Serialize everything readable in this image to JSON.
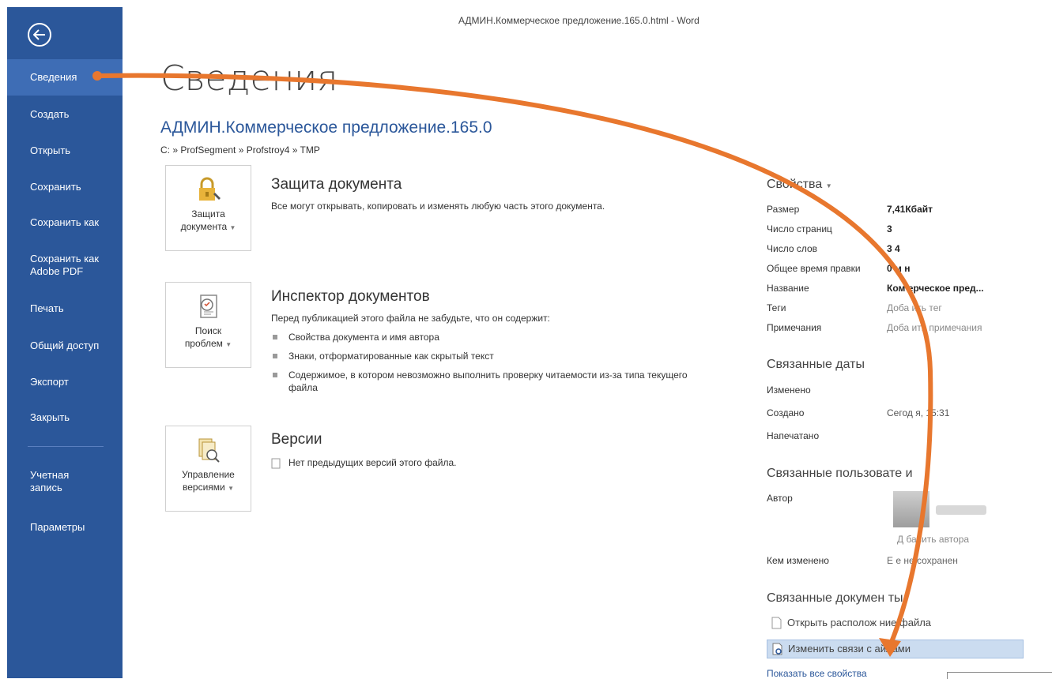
{
  "window": {
    "title": "АДМИН.Коммерческое предложение.165.0.html - Word"
  },
  "sidebar": {
    "items": [
      {
        "label": "Сведения"
      },
      {
        "label": "Создать"
      },
      {
        "label": "Открыть"
      },
      {
        "label": "Сохранить"
      },
      {
        "label": "Сохранить как"
      },
      {
        "label": "Сохранить как\nAdobe PDF"
      },
      {
        "label": "Печать"
      },
      {
        "label": "Общий доступ"
      },
      {
        "label": "Экспорт"
      },
      {
        "label": "Закрыть"
      },
      {
        "label": "Учетная\nзапись"
      },
      {
        "label": "Параметры"
      }
    ]
  },
  "main": {
    "page_title": "Сведения",
    "doc_name": "АДМИН.Коммерческое предложение.165.0",
    "doc_path": "C: » ProfSegment » Profstroy4 » TMP",
    "protect": {
      "tile_label": "Защита\nдокумента",
      "title": "Защита документа",
      "desc": "Все могут открывать, копировать и изменять любую часть этого документа."
    },
    "inspect": {
      "tile_label": "Поиск\nпроблем",
      "title": "Инспектор документов",
      "desc": "Перед публикацией этого файла не забудьте, что он содержит:",
      "bullets": [
        "Свойства документа и имя автора",
        "Знаки, отформатированные как скрытый текст",
        "Содержимое, в котором невозможно выполнить проверку читаемости из-за типа текущего файла"
      ]
    },
    "versions": {
      "tile_label": "Управление\nверсиями",
      "title": "Версии",
      "desc": "Нет предыдущих версий этого файла."
    }
  },
  "props": {
    "heading": "Свойства",
    "rows": [
      {
        "label": "Размер",
        "value": "7,41Кбайт"
      },
      {
        "label": "Число страниц",
        "value": "3"
      },
      {
        "label": "Число слов",
        "value": "3 4"
      },
      {
        "label": "Общее время правки",
        "value": "0 м н"
      },
      {
        "label": "Название",
        "value": "Ком ерческое пред..."
      },
      {
        "label": "Теги",
        "value": "Доба ить тег"
      },
      {
        "label": "Примечания",
        "value": "Доба ить примечания"
      }
    ],
    "dates_heading": "Связанные даты",
    "dates": [
      {
        "label": "Изменено",
        "value": ""
      },
      {
        "label": "Создано",
        "value": "Сегод я, 15:31"
      },
      {
        "label": "Напечатано",
        "value": ""
      }
    ],
    "people_heading": "Связанные пользовате и",
    "author_label": "Автор",
    "add_author": "Д бавить автора",
    "modified_by_label": "Кем изменено",
    "modified_by_value": "Е е не сохранен",
    "docs_heading": "Связанные докумен ты",
    "open_location": "Открыть располож ние файла",
    "edit_links": "Изменить связи с айлами",
    "show_all": "Показать все свойства"
  },
  "colors": {
    "sidebar": "#2b579a",
    "sidebar_active": "#3e6db5",
    "arrow": "#e8772e",
    "link": "#2b579a"
  }
}
